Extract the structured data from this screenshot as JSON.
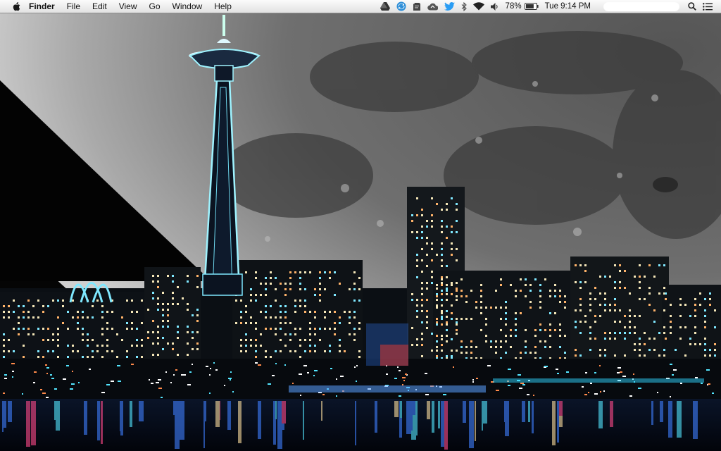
{
  "menubar": {
    "apple_icon": "apple-logo-icon",
    "app_name": "Finder",
    "menus": [
      "File",
      "Edit",
      "View",
      "Go",
      "Window",
      "Help"
    ],
    "status": {
      "battery_percent": "78%",
      "clock": "Tue 9:14 PM",
      "icons": [
        "google-drive-icon",
        "sync-icon",
        "evernote-icon",
        "cloud-app-icon",
        "twitter-icon",
        "bluetooth-icon",
        "wifi-icon",
        "volume-icon",
        "battery-icon",
        "user-name-pill",
        "spotlight-search-icon",
        "notification-center-icon"
      ],
      "battery_level": 0.78
    }
  },
  "desktop": {
    "wallpaper": "Seattle night skyline with Space Needle in front of a large moon",
    "colors": {
      "sky": "#050505",
      "moon": "#9a9a9a",
      "water": "#081020",
      "lights": "#54e6ff"
    }
  }
}
